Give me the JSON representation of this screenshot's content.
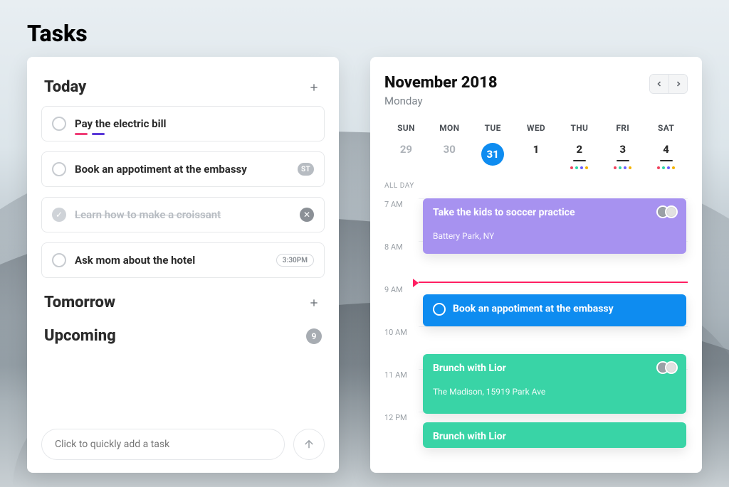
{
  "page": {
    "title": "Tasks"
  },
  "tasks": {
    "sections": {
      "today": {
        "title": "Today",
        "items": [
          {
            "text": "Pay the electric bill",
            "completed": false,
            "underlines": [
              "pink",
              "indigo"
            ]
          },
          {
            "text": "Book an appotiment at the embassy",
            "completed": false,
            "badge": "ST"
          },
          {
            "text": "Learn how to make a croissant",
            "completed": true
          },
          {
            "text": "Ask mom about the hotel",
            "completed": false,
            "time": "3:30PM"
          }
        ]
      },
      "tomorrow": {
        "title": "Tomorrow"
      },
      "upcoming": {
        "title": "Upcoming",
        "count": "9"
      }
    },
    "quick_add_placeholder": "Click to quickly add a task"
  },
  "calendar": {
    "title": "November 2018",
    "subtitle": "Monday",
    "dow": [
      "SUN",
      "MON",
      "TUE",
      "WED",
      "THU",
      "FRI",
      "SAT"
    ],
    "dates": [
      {
        "num": "29",
        "muted": true
      },
      {
        "num": "30",
        "muted": true
      },
      {
        "num": "31",
        "active": true
      },
      {
        "num": "1"
      },
      {
        "num": "2",
        "underline": true,
        "dots": 4
      },
      {
        "num": "3",
        "underline": true,
        "dots": 4
      },
      {
        "num": "4",
        "underline": true,
        "dots": 4
      }
    ],
    "all_day_label": "ALL DAY",
    "hours": [
      "7 AM",
      "8 AM",
      "9 AM",
      "10 AM",
      "11 AM",
      "12 PM"
    ],
    "events": [
      {
        "title": "Take the kids to soccer practice",
        "location": "Battery Park, NY",
        "color": "purple",
        "start_hour_index": 0,
        "height_hours": 1.3,
        "avatars": 2
      },
      {
        "title": "Book an appotiment at the embassy",
        "color": "blue",
        "start_hour_index": 2.25,
        "height_hours": 0.75,
        "ring": true
      },
      {
        "title": "Brunch with Lior",
        "location": "The Madison, 15919 Park Ave",
        "color": "teal",
        "start_hour_index": 3.65,
        "height_hours": 1.4,
        "avatars": 2
      },
      {
        "title": "Brunch with Lior",
        "color": "teal",
        "start_hour_index": 5.25,
        "height_hours": 0.6
      }
    ],
    "now_hour_index": 1.95
  }
}
